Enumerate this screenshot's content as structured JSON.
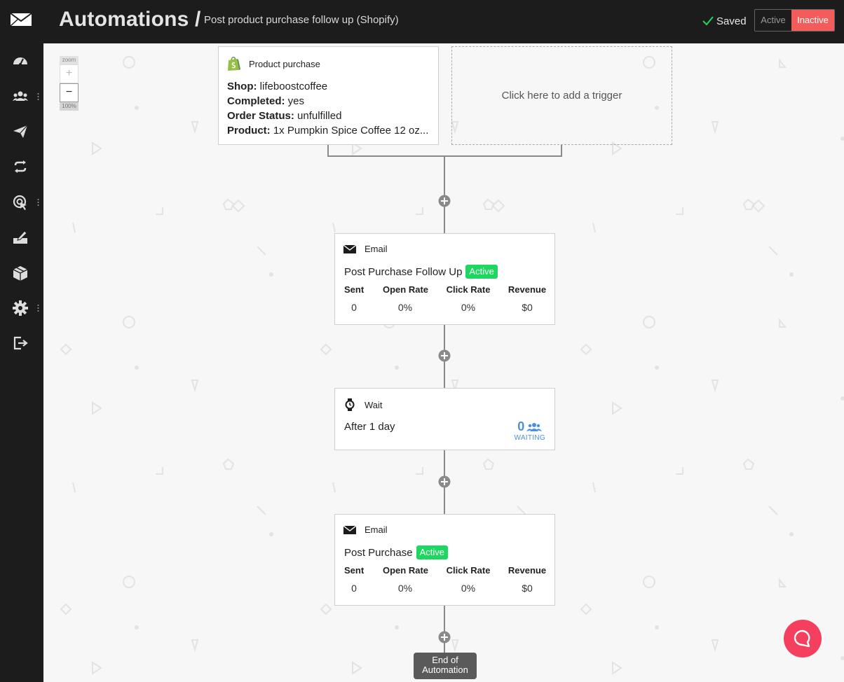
{
  "header": {
    "title": "Automations /",
    "subtitle": "Post product purchase follow up (Shopify)",
    "saved_label": "Saved",
    "toggle_active": "Active",
    "toggle_inactive": "Inactive"
  },
  "sidebar": {
    "items": [
      {
        "icon": "dashboard-icon"
      },
      {
        "icon": "contacts-icon",
        "has_menu": true
      },
      {
        "icon": "campaigns-icon"
      },
      {
        "icon": "automations-icon"
      },
      {
        "icon": "forms-icon",
        "has_menu": true
      },
      {
        "icon": "templates-icon"
      },
      {
        "icon": "products-icon"
      },
      {
        "icon": "settings-icon",
        "has_menu": true
      },
      {
        "icon": "logout-icon"
      }
    ]
  },
  "zoom": {
    "label": "zoom",
    "in": "+",
    "out": "−",
    "level": "100%"
  },
  "trigger": {
    "type": "Product purchase",
    "props": [
      {
        "key": "Shop:",
        "value": "lifeboostcoffee"
      },
      {
        "key": "Completed:",
        "value": "yes"
      },
      {
        "key": "Order Status:",
        "value": "unfulfilled"
      },
      {
        "key": "Product:",
        "value": "1x Pumpkin Spice Coffee 12 oz..."
      }
    ],
    "add_label": "Click here to add a trigger"
  },
  "steps": {
    "email1": {
      "type": "Email",
      "name": "Post Purchase Follow Up",
      "badge": "Active",
      "stats": {
        "sent_label": "Sent",
        "sent": "0",
        "open_label": "Open Rate",
        "open": "0%",
        "click_label": "Click Rate",
        "click": "0%",
        "revenue_label": "Revenue",
        "revenue": "$0"
      }
    },
    "wait": {
      "type": "Wait",
      "desc": "After 1 day",
      "waiting_count": "0",
      "waiting_label": "WAITING"
    },
    "email2": {
      "type": "Email",
      "name": "Post Purchase",
      "badge": "Active",
      "stats": {
        "sent_label": "Sent",
        "sent": "0",
        "open_label": "Open Rate",
        "open": "0%",
        "click_label": "Click Rate",
        "click": "0%",
        "revenue_label": "Revenue",
        "revenue": "$0"
      }
    }
  },
  "end_label_1": "End of",
  "end_label_2": "Automation",
  "colors": {
    "sidebar_bg": "#1c1c1c",
    "inactive_bg": "#f45c5c",
    "active_badge": "#1ed760",
    "waiting_blue": "#4a90e2",
    "chat_btn": "#f43f5e"
  }
}
